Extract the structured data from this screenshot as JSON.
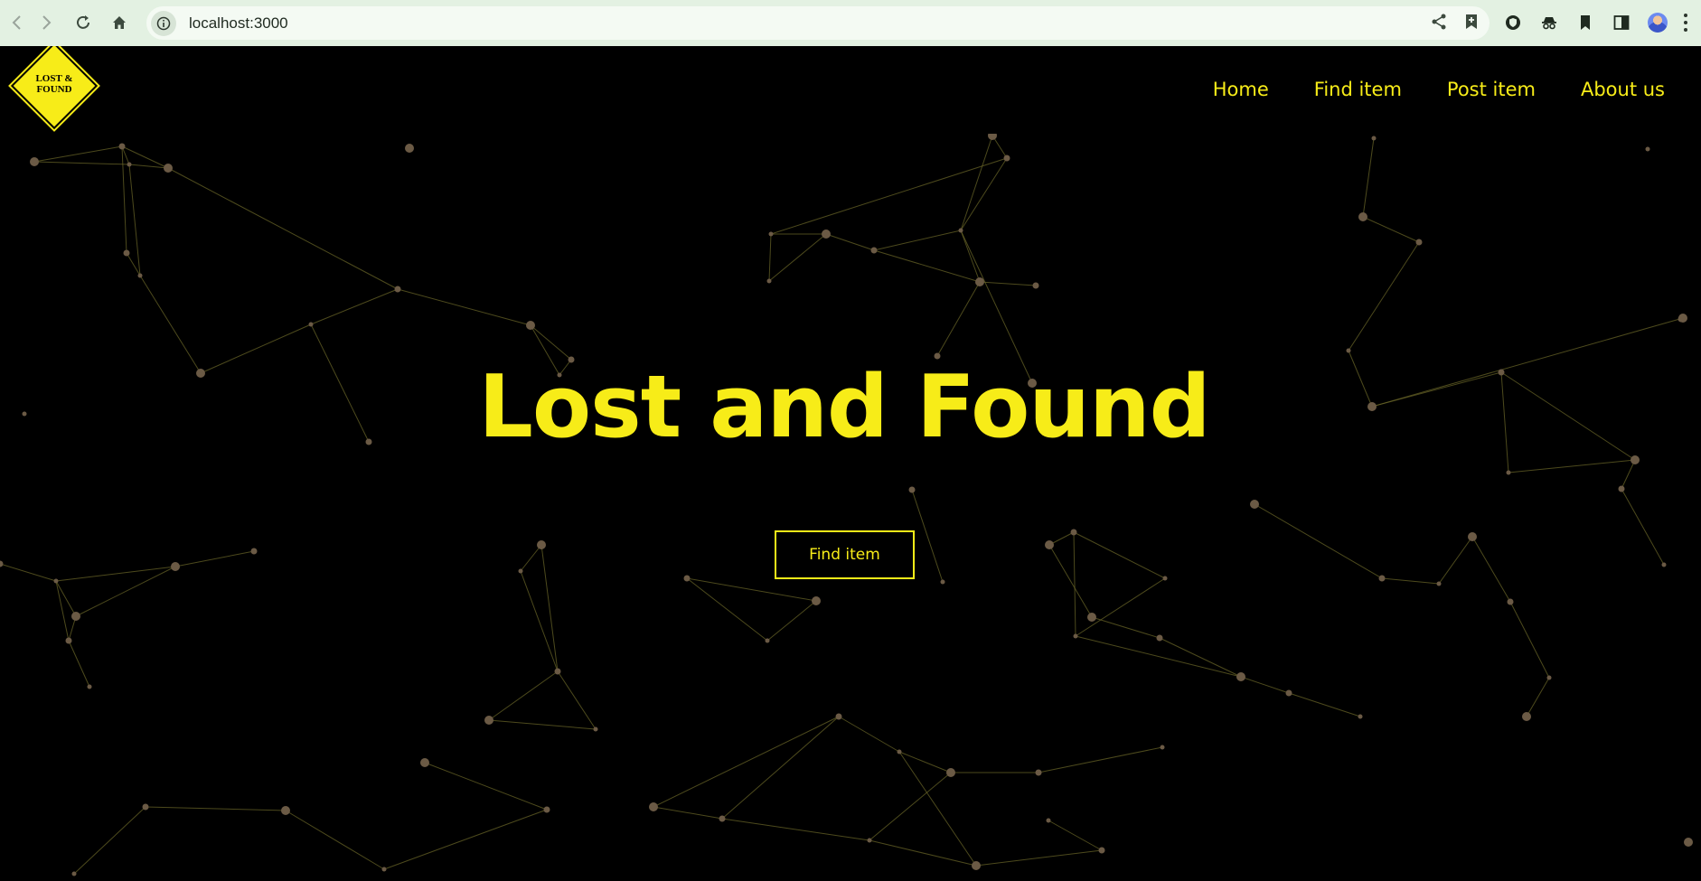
{
  "browser": {
    "url": "localhost:3000",
    "back_icon": "back-arrow-icon",
    "forward_icon": "forward-arrow-icon",
    "reload_icon": "reload-icon",
    "home_icon": "home-icon",
    "site_info_icon": "info-icon",
    "share_icon": "share-icon",
    "bookmark_icon": "bookmark-add-icon",
    "extensions": [
      "shield-extension-icon",
      "incognito-extension-icon",
      "bookmark-extension-icon",
      "sidepanel-icon"
    ],
    "profile_icon": "profile-avatar",
    "menu_icon": "kebab-menu-icon",
    "chrome_color": "#e3f1e2"
  },
  "site": {
    "logo_text_line1": "LOST &",
    "logo_text_line2": "FOUND",
    "accent_color": "#f7ec18",
    "nav": [
      {
        "label": "Home"
      },
      {
        "label": "Find item"
      },
      {
        "label": "Post item"
      },
      {
        "label": "About us"
      }
    ]
  },
  "hero": {
    "title": "Lost and Found",
    "button_label": "Find item"
  }
}
